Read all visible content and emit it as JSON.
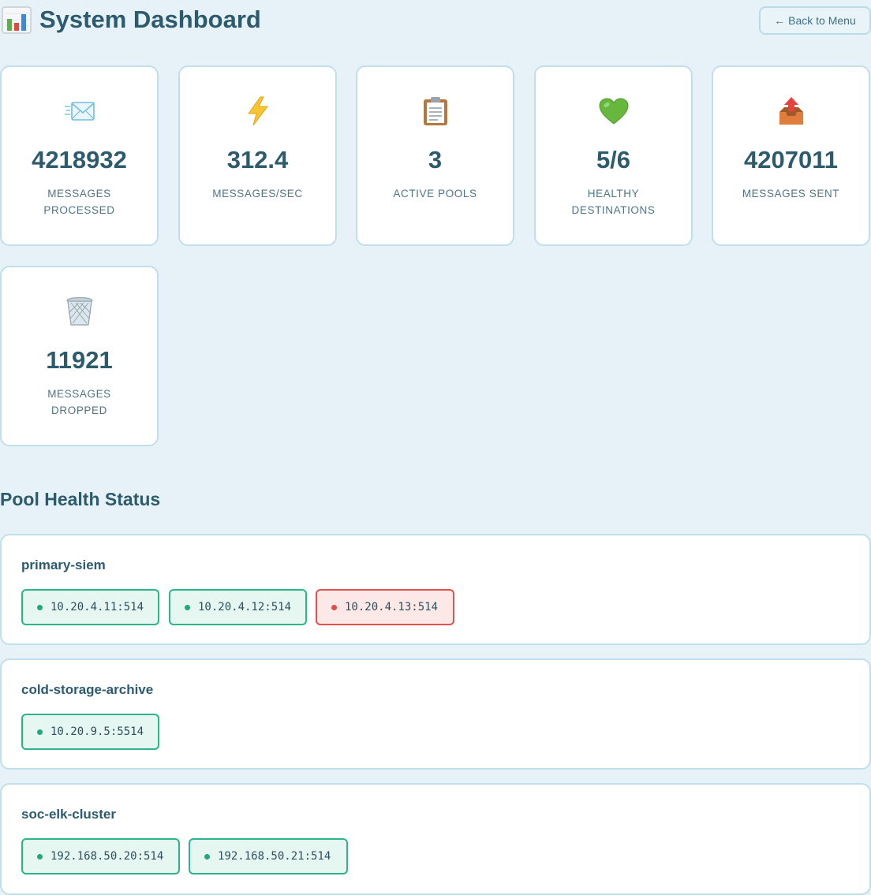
{
  "header": {
    "title": "System Dashboard",
    "title_icon": "bar-chart-icon",
    "back_button": "← Back to Menu"
  },
  "stats": [
    {
      "icon": "envelope-icon",
      "value": "4218932",
      "label": "MESSAGES PROCESSED"
    },
    {
      "icon": "lightning-icon",
      "value": "312.4",
      "label": "MESSAGES/SEC"
    },
    {
      "icon": "clipboard-icon",
      "value": "3",
      "label": "ACTIVE POOLS"
    },
    {
      "icon": "green-heart-icon",
      "value": "5/6",
      "label": "HEALTHY DESTINATIONS"
    },
    {
      "icon": "outbox-tray-icon",
      "value": "4207011",
      "label": "MESSAGES SENT"
    },
    {
      "icon": "wastebasket-icon",
      "value": "11921",
      "label": "MESSAGES DROPPED"
    }
  ],
  "pool_section": {
    "title": "Pool Health Status"
  },
  "pools": [
    {
      "name": "primary-siem",
      "destinations": [
        {
          "address": "10.20.4.11:514",
          "status": "healthy"
        },
        {
          "address": "10.20.4.12:514",
          "status": "healthy"
        },
        {
          "address": "10.20.4.13:514",
          "status": "unhealthy"
        }
      ]
    },
    {
      "name": "cold-storage-archive",
      "destinations": [
        {
          "address": "10.20.9.5:5514",
          "status": "healthy"
        }
      ]
    },
    {
      "name": "soc-elk-cluster",
      "destinations": [
        {
          "address": "192.168.50.20:514",
          "status": "healthy"
        },
        {
          "address": "192.168.50.21:514",
          "status": "healthy"
        }
      ]
    }
  ],
  "colors": {
    "background": "#e6f2f8",
    "text_primary": "#2d5b6e",
    "healthy": "#2ab58a",
    "unhealthy": "#e2504f"
  }
}
